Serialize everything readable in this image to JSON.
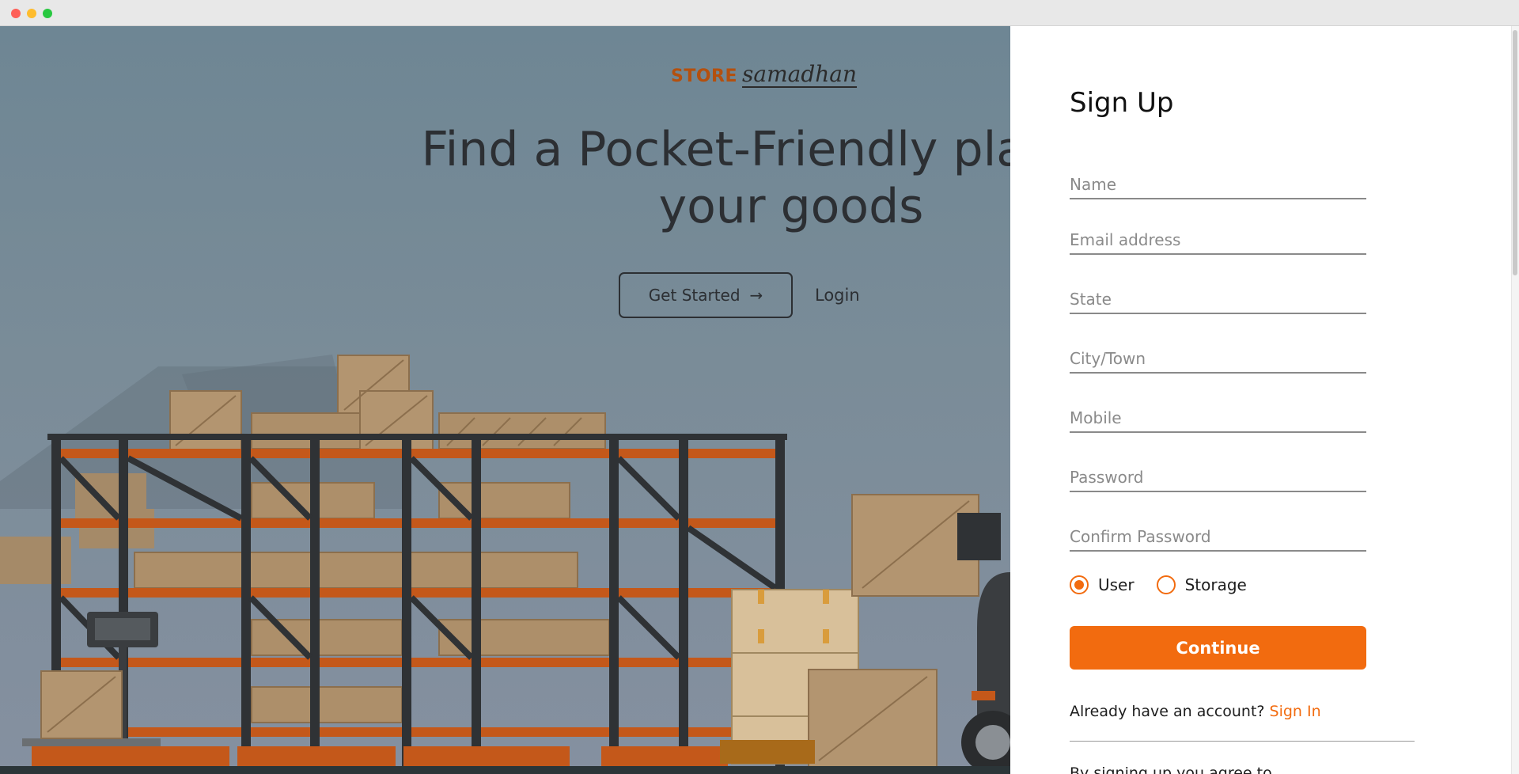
{
  "window": {
    "controls": [
      "close",
      "minimize",
      "maximize"
    ]
  },
  "hero": {
    "logo": {
      "store": "STORE",
      "samadhan": "samadhan"
    },
    "headline_line1": "Find a Pocket-Friendly place for",
    "headline_line2": "your goods",
    "get_started_label": "Get Started",
    "get_started_arrow": "→",
    "login_label": "Login"
  },
  "signup": {
    "title": "Sign Up",
    "fields": {
      "name": "Name",
      "email": "Email address",
      "state": "State",
      "city": "City/Town",
      "mobile": "Mobile",
      "password": "Password",
      "confirm_password": "Confirm Password"
    },
    "roles": [
      {
        "label": "User",
        "checked": true
      },
      {
        "label": "Storage",
        "checked": false
      }
    ],
    "continue_label": "Continue",
    "already_text": "Already have an account?",
    "signin_label": "Sign In",
    "terms_text": "By signing up you agree to"
  },
  "colors": {
    "accent": "#f26b0f",
    "logo_accent": "#b4500e",
    "text_dark": "#2c2f33",
    "hero_bg": "#7a8c98"
  }
}
